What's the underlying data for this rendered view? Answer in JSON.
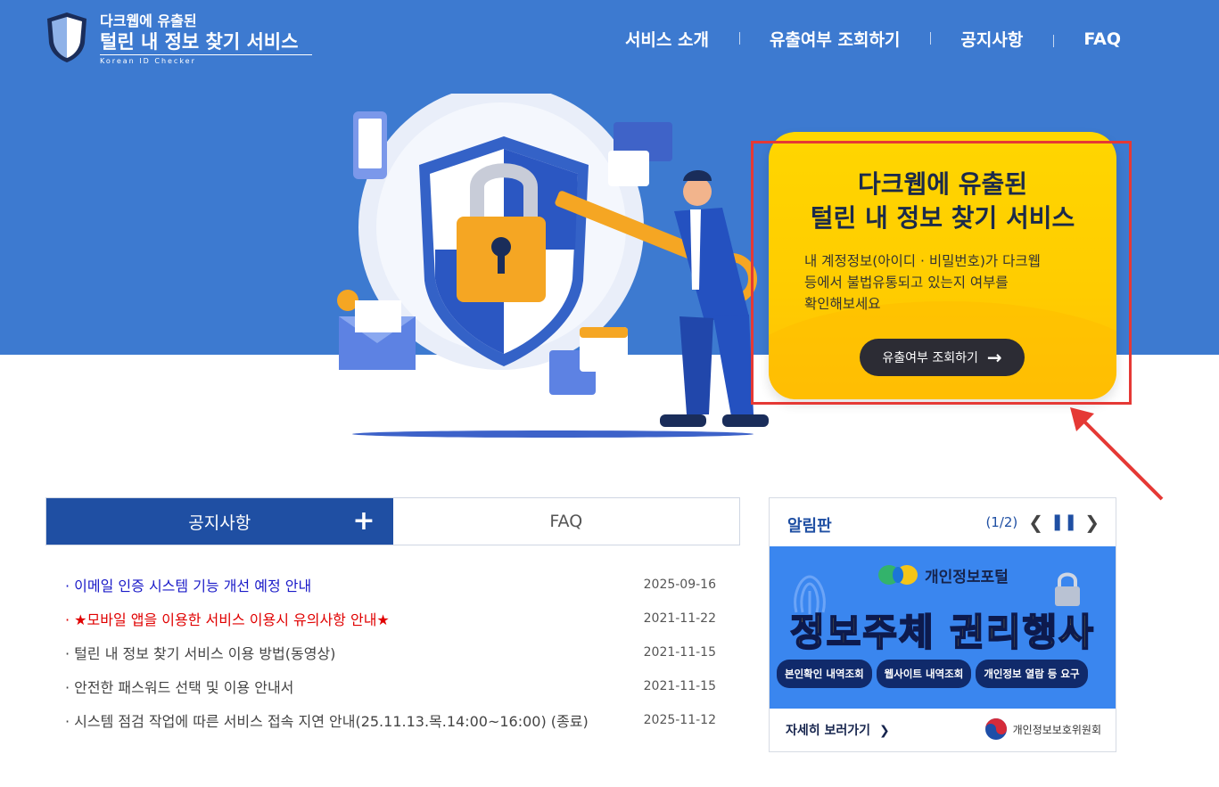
{
  "header": {
    "logo_line1": "다크웹에 유출된",
    "logo_line2": "털린 내 정보 찾기 서비스",
    "logo_line3": "Korean ID Checker",
    "nav": [
      "서비스 소개",
      "유출여부 조회하기",
      "공지사항",
      "FAQ"
    ]
  },
  "promo": {
    "title_line1": "다크웹에 유출된",
    "title_line2": "털린 내 정보 찾기 서비스",
    "desc_line1": "내 계정정보(아이디 · 비밀번호)가 다크웹",
    "desc_line2": "등에서 불법유통되고 있는지 여부를",
    "desc_line3": "확인해보세요",
    "button_label": "유출여부 조회하기"
  },
  "tabs": {
    "notice": "공지사항",
    "faq": "FAQ",
    "plus": "+"
  },
  "notices": [
    {
      "title": "· 이메일 인증 시스템 기능 개선 예정 안내",
      "date": "2025-09-16",
      "style": "blue"
    },
    {
      "title": "· ★모바일 앱을 이용한 서비스 이용시 유의사항 안내★",
      "date": "2021-11-22",
      "style": "red"
    },
    {
      "title": "· 털린 내 정보 찾기 서비스 이용 방법(동영상)",
      "date": "2021-11-15",
      "style": "normal"
    },
    {
      "title": "· 안전한 패스워드 선택 및 이용 안내서",
      "date": "2021-11-15",
      "style": "normal"
    },
    {
      "title": "· 시스템 점검 작업에 따른 서비스 접속 지연 안내(25.11.13.목.14:00~16:00) (종료)",
      "date": "2025-11-12",
      "style": "normal"
    }
  ],
  "board": {
    "title": "알림판",
    "page": "(1/2)",
    "banner_portal": "개인정보포털",
    "banner_main": "정보주체 권리행사",
    "pills": [
      "본인확인 내역조회",
      "웹사이트 내역조회",
      "개인정보 열람 등 요구"
    ],
    "more": "자세히 보러가기",
    "org": "개인정보보호위원회"
  },
  "colors": {
    "hero_bg": "#3d7ad0",
    "promo_yellow": "#ffd600",
    "tab_active": "#1f4fa3",
    "highlight_red": "#e53935"
  }
}
